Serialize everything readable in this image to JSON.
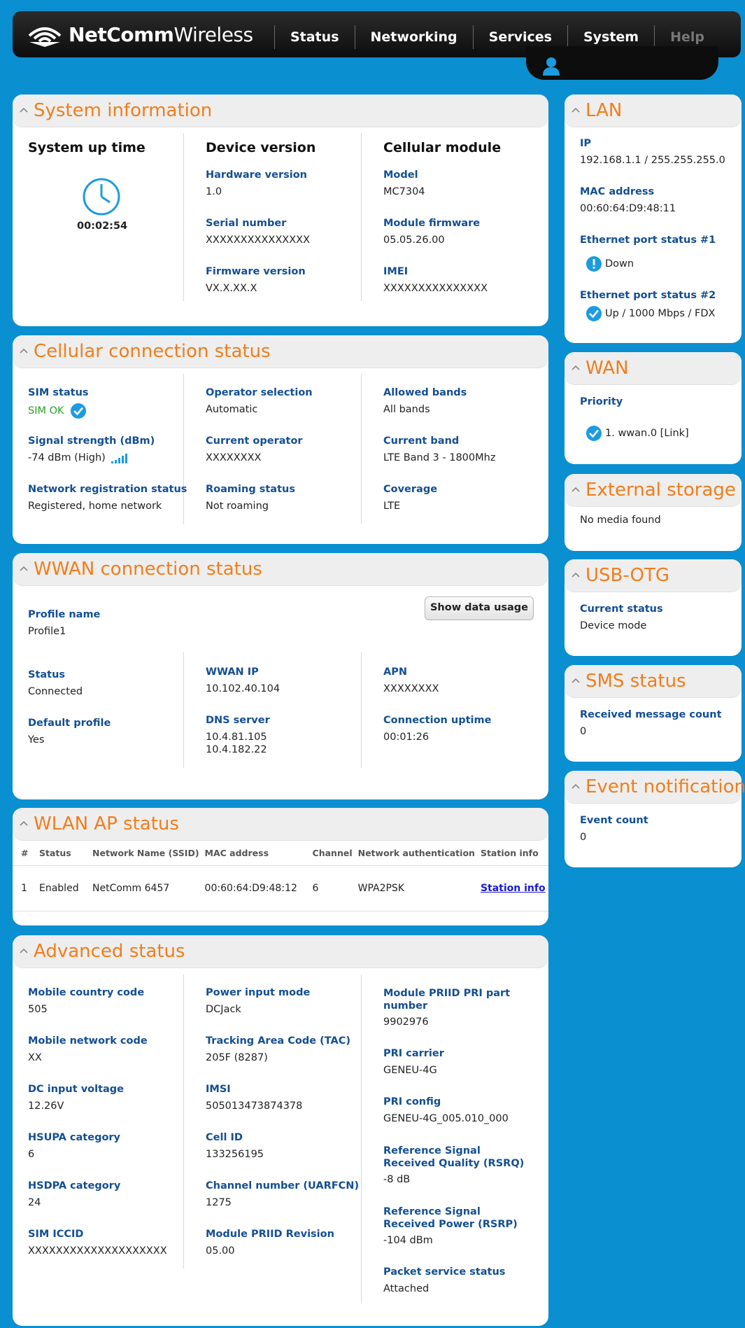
{
  "header": {
    "brand_bold": "NetComm",
    "brand_light": "Wireless",
    "nav": [
      "Status",
      "Networking",
      "Services",
      "System",
      "Help"
    ]
  },
  "system_information": {
    "title": "System information",
    "uptime_heading": "System up time",
    "uptime": "00:02:54",
    "device_heading": "Device version",
    "hardware_label": "Hardware version",
    "hardware_value": "1.0",
    "serial_label": "Serial number",
    "serial_value": "XXXXXXXXXXXXXXX",
    "firmware_label": "Firmware version",
    "firmware_value": "VX.X.XX.X",
    "cellular_heading": "Cellular module",
    "model_label": "Model",
    "model_value": "MC7304",
    "module_fw_label": "Module firmware",
    "module_fw_value": "05.05.26.00",
    "imei_label": "IMEI",
    "imei_value": "XXXXXXXXXXXXXXX"
  },
  "cellular": {
    "title": "Cellular connection status",
    "sim_label": "SIM status",
    "sim_value": "SIM OK",
    "signal_label": "Signal strength (dBm)",
    "signal_value": "-74 dBm (High)",
    "netreg_label": "Network registration status",
    "netreg_value": "Registered, home network",
    "opsel_label": "Operator selection",
    "opsel_value": "Automatic",
    "curop_label": "Current operator",
    "curop_value": "XXXXXXXX",
    "roam_label": "Roaming status",
    "roam_value": "Not roaming",
    "bands_label": "Allowed bands",
    "bands_value": "All bands",
    "curband_label": "Current band",
    "curband_value": "LTE Band 3 - 1800Mhz",
    "coverage_label": "Coverage",
    "coverage_value": "LTE"
  },
  "wwan": {
    "title": "WWAN connection status",
    "profile_label": "Profile name",
    "profile_value": "Profile1",
    "button": "Show data usage",
    "status_label": "Status",
    "status_value": "Connected",
    "default_label": "Default profile",
    "default_value": "Yes",
    "ip_label": "WWAN IP",
    "ip_value": "10.102.40.104",
    "dns_label": "DNS server",
    "dns_value_1": "10.4.81.105",
    "dns_value_2": "10.4.182.22",
    "apn_label": "APN",
    "apn_value": "XXXXXXXX",
    "uptime_label": "Connection uptime",
    "uptime_value": "00:01:26"
  },
  "wlan": {
    "title": "WLAN AP status",
    "columns": [
      "#",
      "Status",
      "Network Name (SSID)",
      "MAC address",
      "Channel",
      "Network authentication",
      "Station info"
    ],
    "rows": [
      [
        "1",
        "Enabled",
        "NetComm 6457",
        "00:60:64:D9:48:12",
        "6",
        "WPA2PSK",
        "Station info"
      ]
    ]
  },
  "advanced": {
    "title": "Advanced status",
    "col1": [
      {
        "label": "Mobile country code",
        "value": "505"
      },
      {
        "label": "Mobile network code",
        "value": "XX"
      },
      {
        "label": "DC input voltage",
        "value": "12.26V"
      },
      {
        "label": "HSUPA category",
        "value": "6"
      },
      {
        "label": "HSDPA category",
        "value": "24"
      },
      {
        "label": "SIM ICCID",
        "value": "XXXXXXXXXXXXXXXXXXXX"
      }
    ],
    "col2": [
      {
        "label": "Power input mode",
        "value": "DCJack"
      },
      {
        "label": "Tracking Area Code (TAC)",
        "value": "205F (8287)"
      },
      {
        "label": "IMSI",
        "value": "505013473874378"
      },
      {
        "label": "Cell ID",
        "value": "133256195"
      },
      {
        "label": "Channel number (UARFCN)",
        "value": "1275"
      },
      {
        "label": "Module PRIID Revision",
        "value": "05.00"
      }
    ],
    "col3": [
      {
        "label": "Module PRIID PRI part number",
        "value": "9902976"
      },
      {
        "label": "PRI carrier",
        "value": "GENEU-4G"
      },
      {
        "label": "PRI config",
        "value": "GENEU-4G_005.010_000"
      },
      {
        "label": "Reference Signal Received Quality (RSRQ)",
        "value": "-8 dB"
      },
      {
        "label": "Reference Signal Received Power (RSRP)",
        "value": "-104 dBm"
      },
      {
        "label": "Packet service status",
        "value": "Attached"
      }
    ]
  },
  "lan": {
    "title": "LAN",
    "ip_label": "IP",
    "ip_value": "192.168.1.1 / 255.255.255.0",
    "mac_label": "MAC address",
    "mac_value": "00:60:64:D9:48:11",
    "eth1_label": "Ethernet port status #1",
    "eth1_value": "Down",
    "eth2_label": "Ethernet port status #2",
    "eth2_value": "Up / 1000 Mbps / FDX"
  },
  "wan": {
    "title": "WAN",
    "priority_label": "Priority",
    "priority_value": "1. wwan.0 [Link]"
  },
  "external_storage": {
    "title": "External storage",
    "value": "No media found"
  },
  "usb_otg": {
    "title": "USB-OTG",
    "label": "Current status",
    "value": "Device mode"
  },
  "sms": {
    "title": "SMS status",
    "label": "Received message count",
    "value": "0"
  },
  "events": {
    "title": "Event notification",
    "label": "Event count",
    "value": "0"
  },
  "colors": {
    "background": "#0a8fd1",
    "accent_title": "#f07e1b",
    "label_blue": "#134f93",
    "ok_green": "#2aa02a",
    "check_blue": "#1d9be0"
  }
}
